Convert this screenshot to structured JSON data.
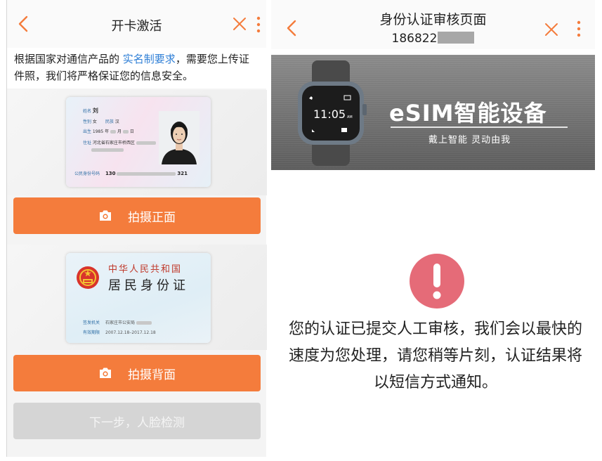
{
  "left": {
    "title": "开卡激活",
    "notice_before": "根据国家对通信产品的",
    "notice_link": "实名制要求",
    "notice_after": "，需要您上传证件照，我们将严格保证您的信息安全。",
    "front_card": {
      "name_key": "姓名",
      "name_val": "刘",
      "sex_key": "性别",
      "sex_val": "女",
      "ethnic_key": "民族",
      "ethnic_val": "汉",
      "birth_key": "出生",
      "birth_val": "1985 年",
      "month_key": "月",
      "day_key": "日",
      "addr_key": "住址",
      "addr_val": "河北省石家庄市桥西区",
      "id_key": "公民身份号码",
      "id_start": "130",
      "id_end": "321"
    },
    "back_card": {
      "nation": "中华人民共和国",
      "card_name": "居民身份证",
      "authority_key": "签发机关",
      "authority_val": "石家庄市公安局",
      "validity_key": "有效期限",
      "validity_val": "2007.12.18–2017.12.18"
    },
    "front_button": "拍摄正面",
    "back_button": "拍摄背面",
    "next_button": "下一步，人脸检测"
  },
  "right": {
    "title": "身份认证审核页面",
    "phone_prefix": "186822",
    "banner_brand": "eSIM智能设备",
    "banner_slogan": "戴上智能 灵动由我",
    "watch_time": "11:05",
    "watch_ampm": "AM",
    "message": "您的认证已提交人工审核，我们会以最快的速度为您处理，请您稍等片刻，认证结果将以短信方式通知。"
  },
  "colors": {
    "accent": "#f47c3c",
    "link": "#2f7fd6",
    "alert": "#e56b78",
    "disabled": "#d5d5d5"
  }
}
